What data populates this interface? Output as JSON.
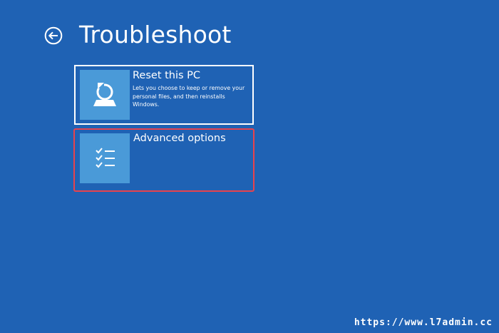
{
  "page": {
    "title": "Troubleshoot",
    "back_icon": "back-arrow-circle-icon"
  },
  "options": {
    "reset": {
      "title": "Reset this PC",
      "description": "Lets you choose to keep or remove your personal files, and then reinstalls Windows.",
      "icon": "reset-pc-icon"
    },
    "advanced": {
      "title": "Advanced options",
      "icon": "checklist-icon",
      "highlighted": true
    }
  },
  "watermark": "https://www.l7admin.cc",
  "colors": {
    "background": "#1f62b4",
    "tile_icon_bg": "#4a9ad8",
    "highlight_border": "#e8434d",
    "text": "#ffffff"
  }
}
